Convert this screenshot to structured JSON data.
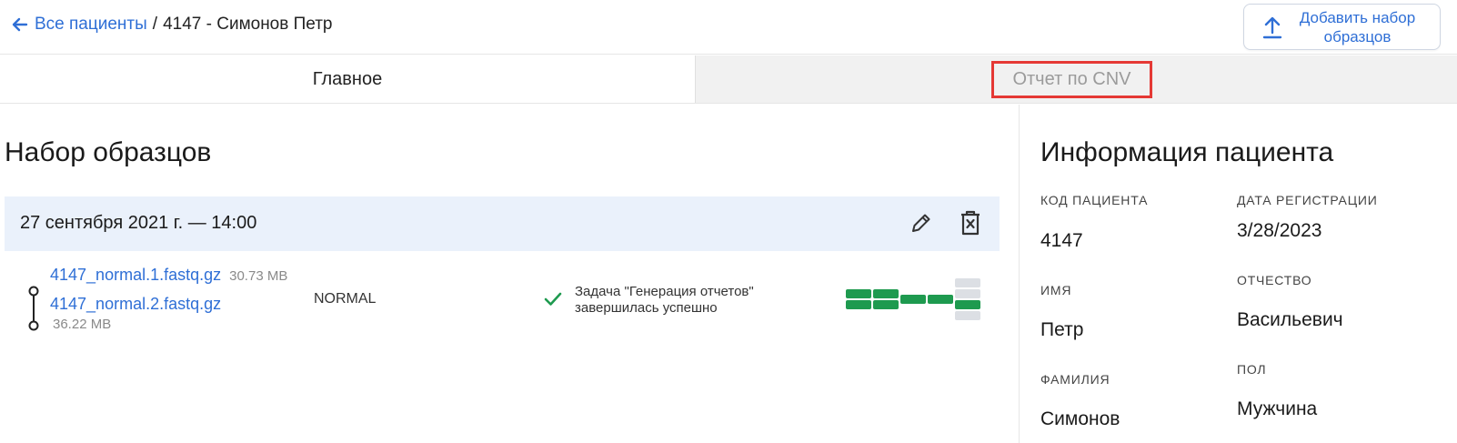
{
  "breadcrumb": {
    "back_label": "Все пациенты",
    "separator": "/",
    "current": "4147 - Симонов Петр"
  },
  "add_button": {
    "label": "Добавить набор образцов"
  },
  "tabs": [
    {
      "label": "Главное",
      "active": true
    },
    {
      "label": "Отчет по CNV",
      "active": false,
      "highlighted": true
    }
  ],
  "sample_set": {
    "title": "Набор образцов",
    "date": "27 сентября 2021 г. — 14:00",
    "files": [
      {
        "name": "4147_normal.1.fastq.gz",
        "size": "30.73 MB"
      },
      {
        "name": "4147_normal.2.fastq.gz",
        "size": "36.22 MB"
      }
    ],
    "type": "NORMAL",
    "status_line1": "Задача \"Генерация отчетов\"",
    "status_line2": "завершилась успешно",
    "progress_steps": [
      "done",
      "done",
      "done",
      "done",
      "done"
    ]
  },
  "patient_info": {
    "title": "Информация пациента",
    "code_label": "КОД ПАЦИЕНТА",
    "code_value": "4147",
    "reg_date_label": "ДАТА РЕГИСТРАЦИИ",
    "reg_date_value": "3/28/2023",
    "first_name_label": "ИМЯ",
    "first_name_value": "Петр",
    "patronymic_label": "ОТЧЕСТВО",
    "patronymic_value": "Васильевич",
    "last_name_label": "ФАМИЛИЯ",
    "last_name_value": "Симонов",
    "sex_label": "ПОЛ",
    "sex_value": "Мужчина"
  },
  "colors": {
    "link": "#2f6fd6",
    "success": "#1e9a4f",
    "highlight_border": "#e53935",
    "set_header_bg": "#eaf1fb",
    "inactive_tab_bg": "#f1f1f1"
  }
}
